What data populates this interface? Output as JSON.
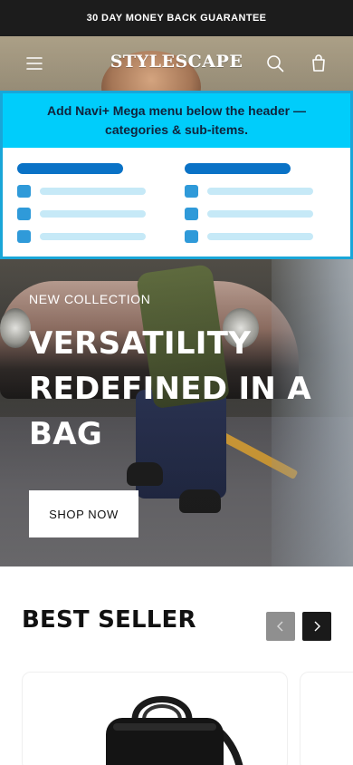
{
  "announcement": {
    "text": "30 DAY MONEY BACK GUARANTEE"
  },
  "header": {
    "logo": "STYLESCAPE",
    "icons": {
      "menu": "hamburger-menu-icon",
      "search": "search-icon",
      "cart": "shopping-bag-icon"
    }
  },
  "mega_menu": {
    "banner_text": "Add Navi+ Mega menu below the header — categories & sub-items.",
    "accent_color": "#00cdfb",
    "columns": [
      {
        "category": "",
        "items": [
          "",
          "",
          ""
        ]
      },
      {
        "category": "",
        "items": [
          "",
          "",
          ""
        ]
      }
    ]
  },
  "hero": {
    "eyebrow": "NEW COLLECTION",
    "title": "VERSATILITY REDEFINED IN A BAG",
    "cta": "SHOP NOW"
  },
  "best_seller": {
    "title": "BEST SELLER",
    "icons": {
      "prev": "chevron-left-icon",
      "next": "chevron-right-icon"
    }
  },
  "colors": {
    "announcement_bg": "#1c1c1c",
    "cta_bg": "#ffffff",
    "arrow_active": "#1a1a1a",
    "arrow_disabled": "#8f8f8f"
  }
}
